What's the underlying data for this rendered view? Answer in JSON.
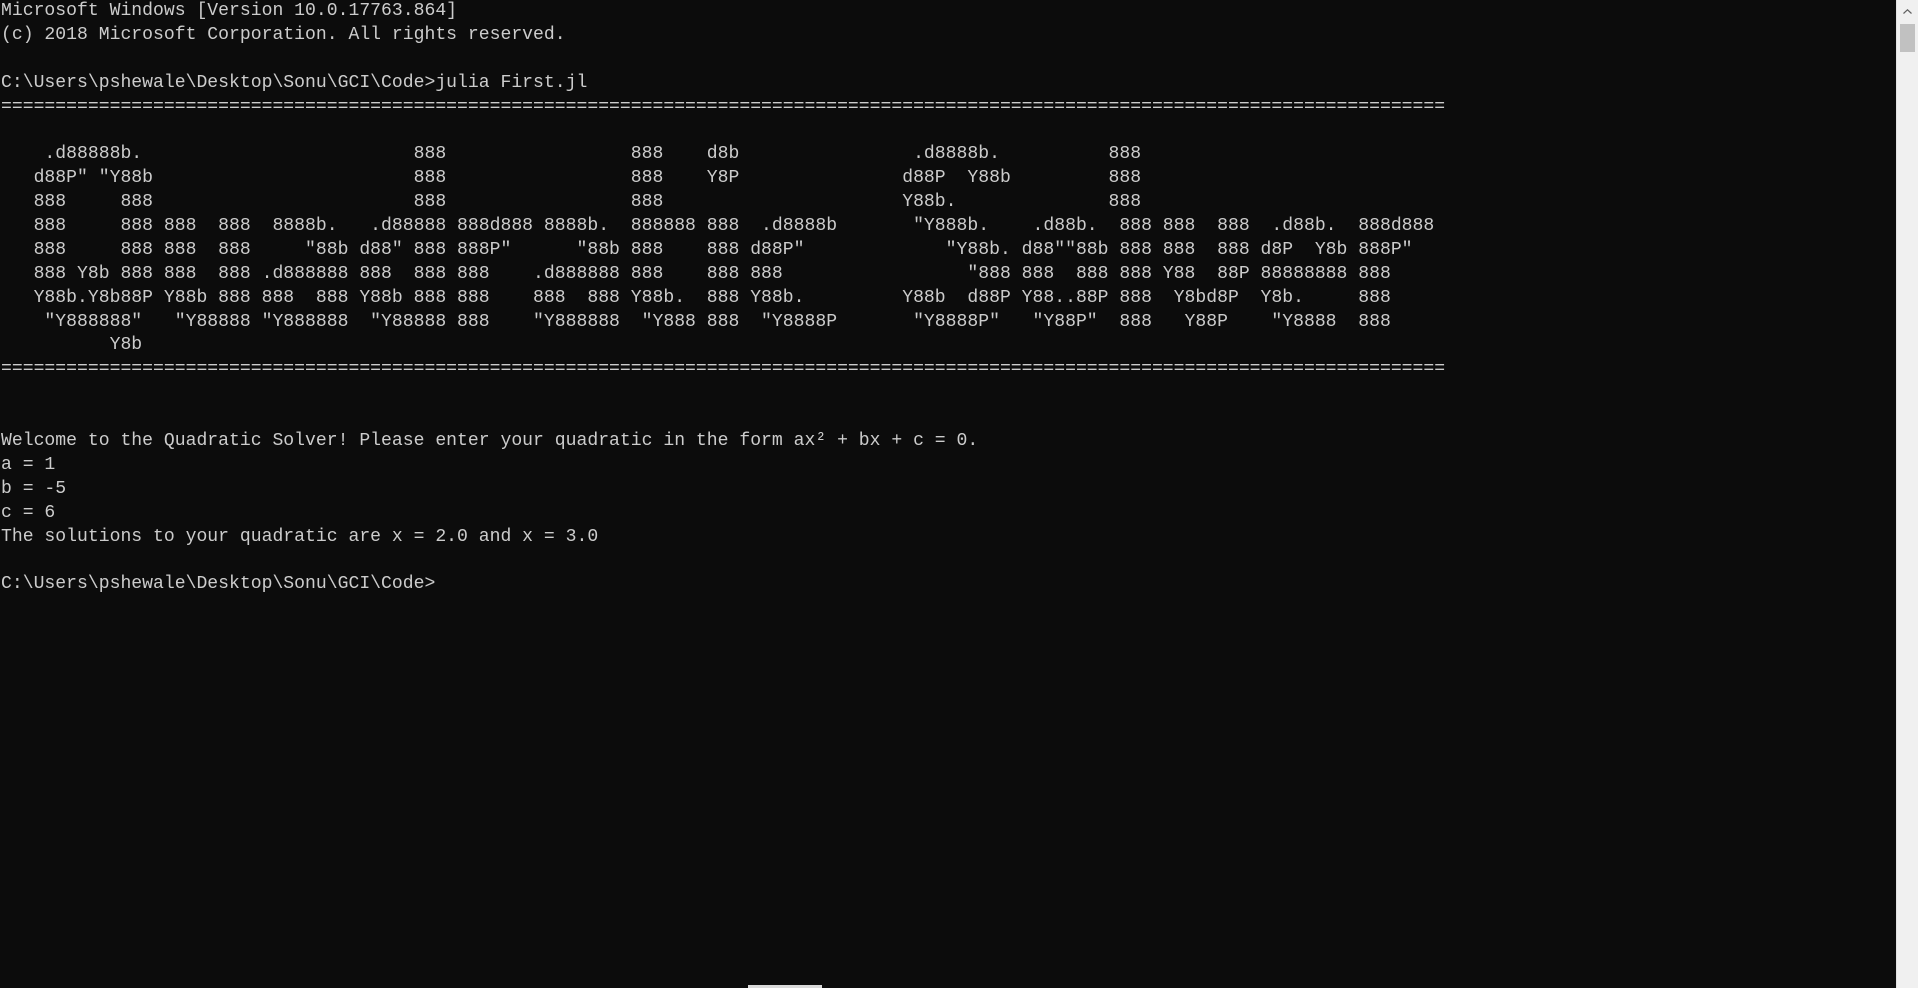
{
  "console": {
    "lines": [
      "Microsoft Windows [Version 10.0.17763.864]",
      "(c) 2018 Microsoft Corporation. All rights reserved.",
      "",
      "C:\\Users\\pshewale\\Desktop\\Sonu\\GCI\\Code>julia First.jl",
      "=====================================================================================================================================",
      "",
      "    .d88888b.                         888                 888    d8b                .d8888b.          888",
      "   d88P\" \"Y88b                        888                 888    Y8P               d88P  Y88b         888",
      "   888     888                        888                 888                      Y88b.              888",
      "   888     888 888  888  8888b.   .d88888 888d888 8888b.  888888 888  .d8888b       \"Y888b.    .d88b.  888 888  888  .d88b.  888d888",
      "   888     888 888  888     \"88b d88\" 888 888P\"      \"88b 888    888 d88P\"             \"Y88b. d88\"\"88b 888 888  888 d8P  Y8b 888P\"",
      "   888 Y8b 888 888  888 .d888888 888  888 888    .d888888 888    888 888                 \"888 888  888 888 Y88  88P 88888888 888",
      "   Y88b.Y8b88P Y88b 888 888  888 Y88b 888 888    888  888 Y88b.  888 Y88b.         Y88b  d88P Y88..88P 888  Y8bd8P  Y8b.     888",
      "    \"Y888888\"   \"Y88888 \"Y888888  \"Y88888 888    \"Y888888  \"Y888 888  \"Y8888P       \"Y8888P\"   \"Y88P\"  888   Y88P    \"Y8888  888",
      "          Y8b",
      "=====================================================================================================================================",
      "",
      "",
      "Welcome to the Quadratic Solver! Please enter your quadratic in the form ax² + bx + c = 0.",
      "a = 1",
      "b = -5",
      "c = 6",
      "The solutions to your quadratic are x = 2.0 and x = 3.0",
      "",
      "C:\\Users\\pshewale\\Desktop\\Sonu\\GCI\\Code>"
    ]
  },
  "scrollbar": {
    "up_arrow_icon": "chevron-up-icon",
    "background": "#f0f0f0",
    "thumb_color": "#c1c1c1"
  },
  "theme": {
    "background": "#0c0c0c",
    "foreground": "#cccccc"
  }
}
